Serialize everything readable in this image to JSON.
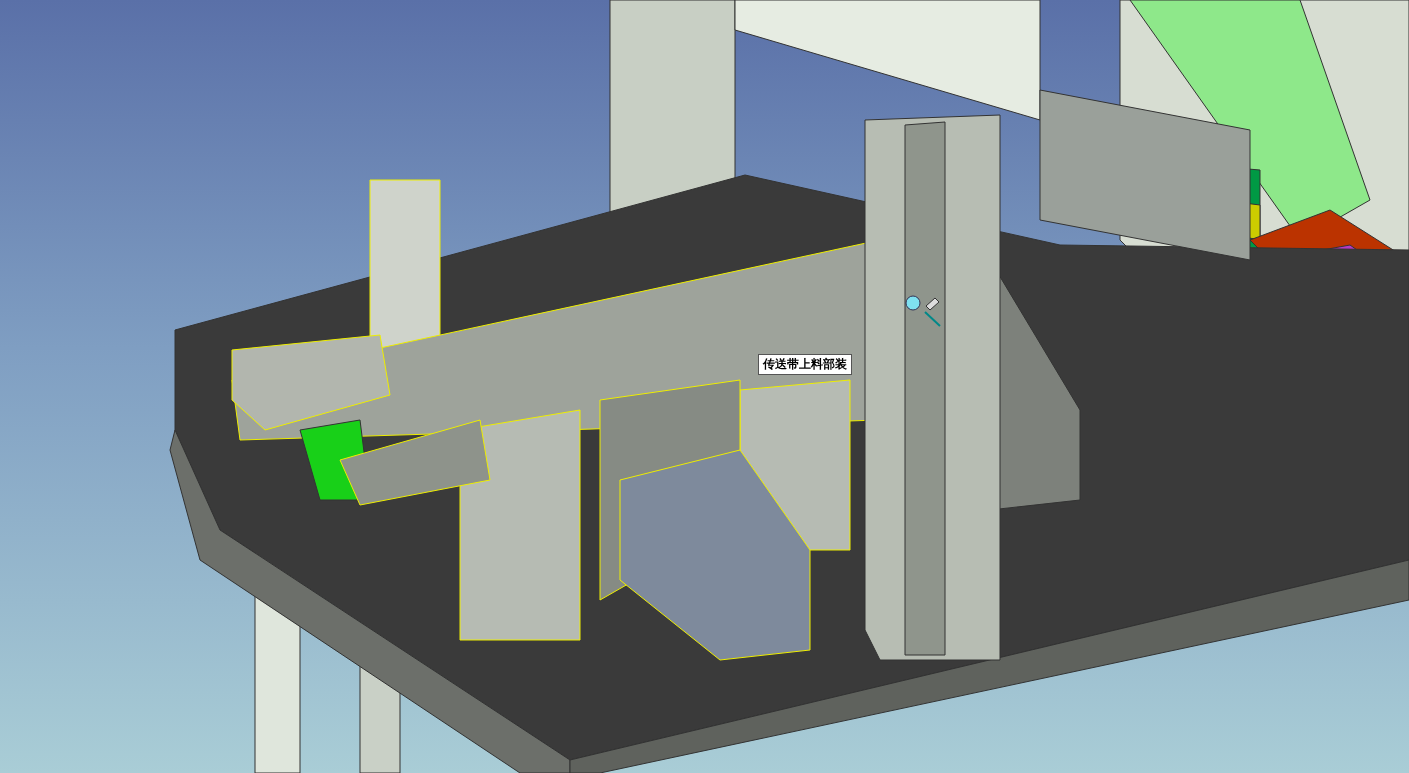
{
  "viewport": {
    "tooltip": {
      "text": "传送带上料部装"
    }
  }
}
